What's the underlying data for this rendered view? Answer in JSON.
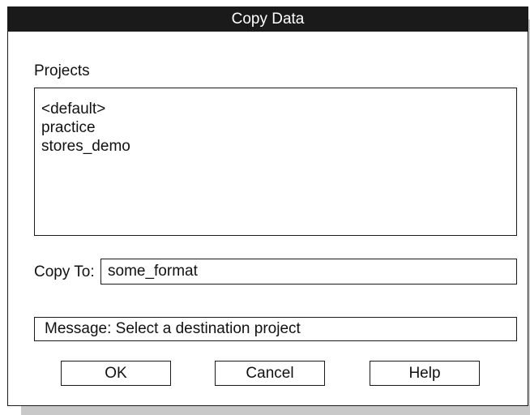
{
  "dialog": {
    "title": "Copy Data",
    "projects_label": "Projects",
    "projects": [
      "<default>",
      "practice",
      "stores_demo"
    ],
    "copy_to_label": "Copy To:",
    "copy_to_value": "some_format",
    "message": "Message: Select a destination project"
  },
  "buttons": {
    "ok_label": "OK",
    "cancel_label": "Cancel",
    "help_label": "Help"
  }
}
